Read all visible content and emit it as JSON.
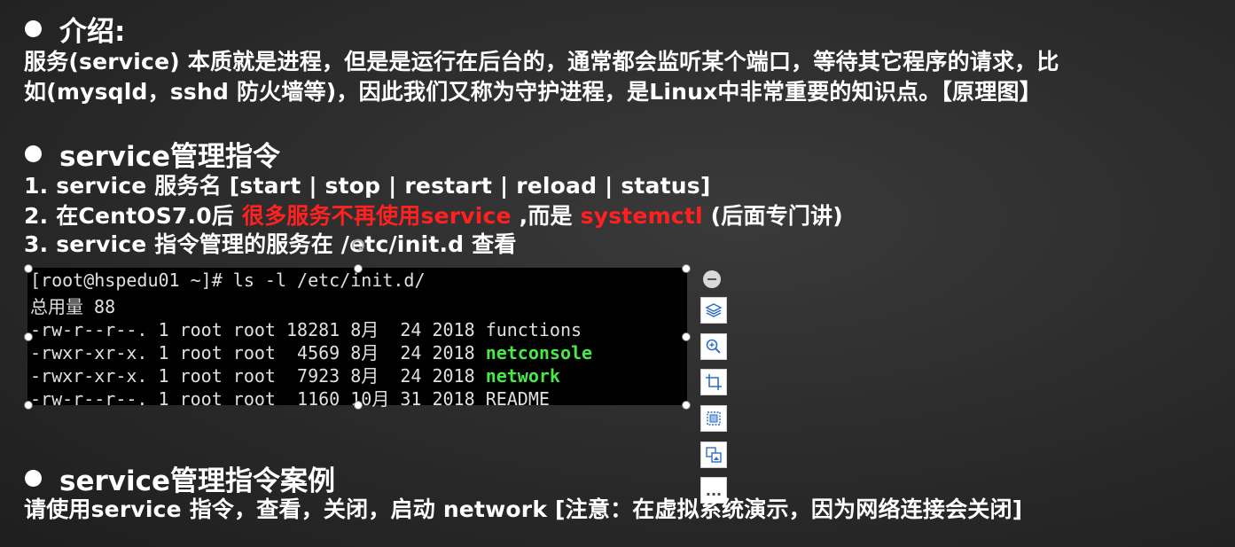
{
  "intro": {
    "heading": "介绍:",
    "line1": "服务(service) 本质就是进程，但是是运行在后台的，通常都会监听某个端口，等待其它程序的请求，比",
    "line2": "如(mysqld，sshd  防火墙等)，因此我们又称为守护进程，是Linux中非常重要的知识点。【原理图】"
  },
  "service_cmd": {
    "heading": "service管理指令",
    "item1": "1.  service  服务名 [start | stop | restart | reload | status]",
    "item2_pre": "2.  在CentOS7.0后 ",
    "item2_red1": "很多服务不再使用service",
    "item2_mid": " ,而是 ",
    "item2_red2": "systemctl",
    "item2_post": " (后面专门讲)",
    "item3": "3.  service 指令管理的服务在 /etc/init.d 查看"
  },
  "terminal": {
    "line1": "[root@hspedu01 ~]# ls -l /etc/init.d/",
    "line2": "总用量 88",
    "rows": [
      {
        "prefix": "-rw-r--r--. 1 root root 18281 8月  24 2018 ",
        "name": "functions"
      },
      {
        "prefix": "-rwxr-xr-x. 1 root root  4569 8月  24 2018 ",
        "name": "netconsole"
      },
      {
        "prefix": "-rwxr-xr-x. 1 root root  7923 8月  24 2018 ",
        "name": "network"
      },
      {
        "prefix": "-rw-r--r--. 1 root root  1160 10月 31 2018 ",
        "name": "README"
      }
    ]
  },
  "toolbar": {
    "icons": [
      "minus-circle-icon",
      "layers-icon",
      "zoom-in-icon",
      "crop-icon",
      "fit-icon",
      "replace-image-icon",
      "more-icon"
    ],
    "more_label": "..."
  },
  "case": {
    "heading": "service管理指令案例",
    "line": "请使用service 指令，查看，关闭，启动 network [注意：在虚拟系统演示，因为网络连接会关闭]"
  },
  "colors": {
    "background": "#2a2a2a",
    "text": "#ffffff",
    "highlight_red": "#ff2020",
    "terminal_bg": "#000000",
    "terminal_green": "#49e849"
  }
}
